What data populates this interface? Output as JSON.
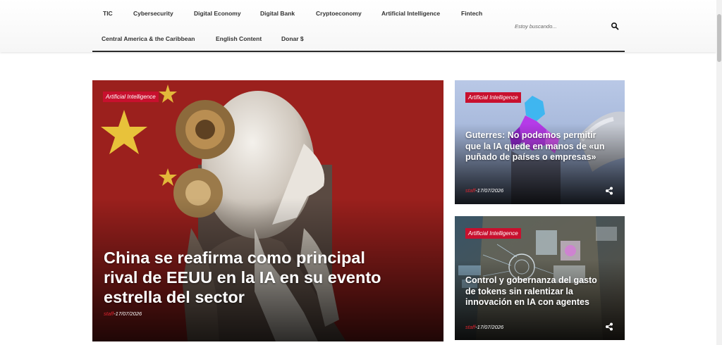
{
  "nav": {
    "items": [
      {
        "label": "TIC"
      },
      {
        "label": "Cybersecurity"
      },
      {
        "label": "Digital Economy"
      },
      {
        "label": "Digital Bank"
      },
      {
        "label": "Cryptoeconomy"
      },
      {
        "label": "Artificial Intelligence"
      },
      {
        "label": "Fintech"
      },
      {
        "label": "Central America & the Caribbean"
      },
      {
        "label": "English Content"
      },
      {
        "label": "Donar $"
      }
    ]
  },
  "search": {
    "placeholder": "Estoy buscando...",
    "icon": "search-icon"
  },
  "articles": [
    {
      "category": "Artificial Intelligence",
      "title": "China se reafirma como principal rival de EEUU en la IA en su evento estrella del sector",
      "author": "staff",
      "date": "-17/07/2026"
    },
    {
      "category": "Artificial Intelligence",
      "title": "Guterres: No podemos permitir que la IA quede en manos de «un puñado de países o empresas»",
      "author": "staff",
      "date": "-17/07/2026"
    },
    {
      "category": "Artificial Intelligence",
      "title": "Control y gobernanza del gasto de tokens sin ralentizar la innovación en IA con agentes",
      "author": "staff",
      "date": "-17/07/2026"
    }
  ],
  "colors": {
    "badge": "#c8102e",
    "author": "#e0242f",
    "nav_underline": "#2b2b2b"
  }
}
